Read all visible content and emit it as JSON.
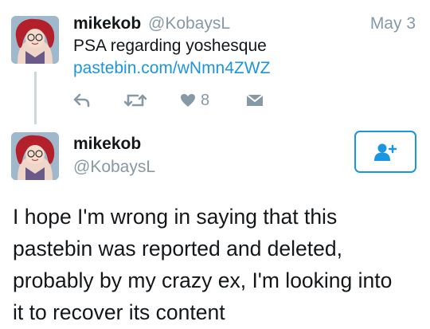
{
  "reply_tweet": {
    "author_name": "mikekob",
    "author_handle": "@KobaysL",
    "date": "May 3",
    "text": "PSA regarding yoshesque",
    "link": "pastebin.com/wNmn4ZWZ",
    "actions": {
      "reply_icon": "reply-icon",
      "retweet_icon": "retweet-icon",
      "like_icon": "heart-icon",
      "like_count": "8",
      "dm_icon": "envelope-icon"
    }
  },
  "main_tweet": {
    "author_name": "mikekob",
    "author_handle": "@KobaysL",
    "follow_icon": "follow-user-icon",
    "body_lines": [
      "I hope I'm wrong in saying that this",
      "pastebin was reported and deleted,",
      "probably by my crazy ex, I'm looking into",
      "it to recover its content"
    ]
  },
  "colors": {
    "accent": "#1b95e0",
    "muted": "#8899a6",
    "text": "#14171a",
    "thread_line": "#ccd6dd"
  }
}
